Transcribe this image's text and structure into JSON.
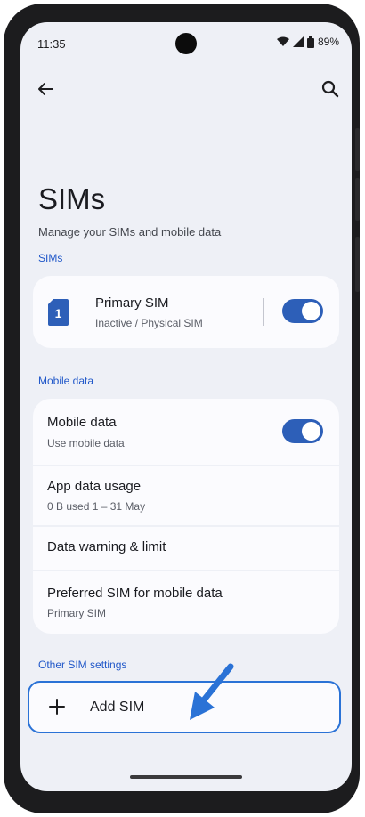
{
  "status_bar": {
    "time": "11:35",
    "battery": "89%"
  },
  "header": {
    "back_icon": "arrow-left-icon",
    "search_icon": "search-icon"
  },
  "page": {
    "title": "SIMs",
    "subtitle": "Manage your SIMs and mobile data"
  },
  "sims_section": {
    "label": "SIMs",
    "sim": {
      "badge": "1",
      "name": "Primary SIM",
      "status": "Inactive / Physical SIM",
      "enabled": true
    }
  },
  "mobile_data_section": {
    "label": "Mobile data",
    "items": [
      {
        "title": "Mobile data",
        "subtitle": "Use mobile data",
        "toggle": true
      },
      {
        "title": "App data usage",
        "subtitle": "0 B used 1 – 31 May"
      },
      {
        "title": "Data warning & limit"
      },
      {
        "title": "Preferred SIM for mobile data",
        "subtitle": "Primary SIM"
      }
    ]
  },
  "other_section": {
    "label": "Other SIM settings",
    "add_sim": {
      "label": "Add SIM",
      "icon": "plus-icon"
    }
  },
  "colors": {
    "accent": "#2d5fb8",
    "section_label": "#2158c9",
    "highlight": "#2a72d6",
    "background": "#eef0f6",
    "card": "#fbfbfe"
  }
}
